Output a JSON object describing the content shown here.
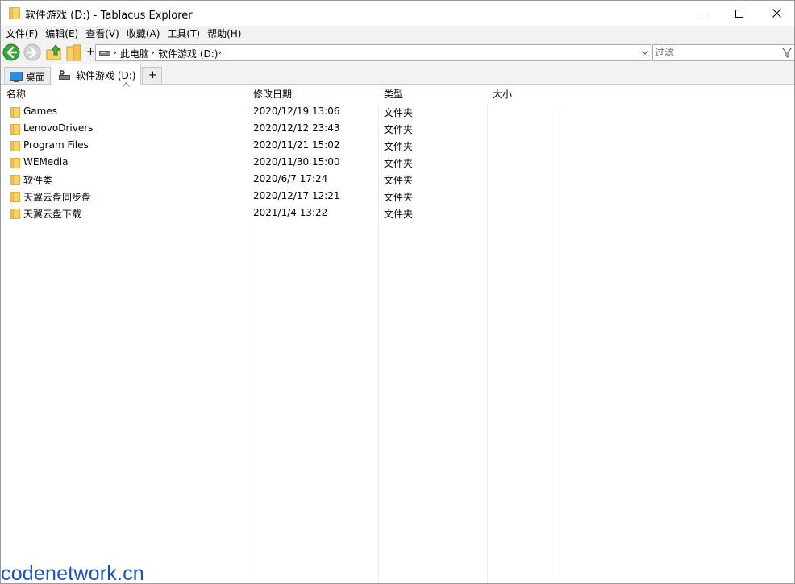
{
  "window": {
    "title": "软件游戏 (D:) - Tablacus Explorer",
    "title_icon": "folder-icon",
    "controls": [
      "minimize-icon",
      "maximize-icon",
      "close-icon"
    ]
  },
  "menu": [
    "文件(F)",
    "编辑(E)",
    "查看(V)",
    "收藏(A)",
    "工具(T)",
    "帮助(H)"
  ],
  "toolbar": {
    "icons": [
      "back-arrow-icon",
      "forward-arrow-icon",
      "up-folder-icon",
      "folders-icon"
    ],
    "new_tab_plus": "+",
    "breadcrumb": [
      "此电脑",
      "软件游戏 (D:)"
    ],
    "filter_placeholder": "过滤"
  },
  "tabs": [
    {
      "label": "桌面",
      "icon": "desktop-icon",
      "active": false
    },
    {
      "label": "软件游戏 (D:)",
      "icon": "drive-icon",
      "active": true
    },
    {
      "label": "+",
      "active": false
    }
  ],
  "columns": {
    "name": "名称",
    "modified": "修改日期",
    "type": "类型",
    "size": "大小"
  },
  "rows": [
    {
      "name": "Games",
      "modified": "2020/12/19 13:06",
      "type": "文件夹",
      "size": ""
    },
    {
      "name": "LenovoDrivers",
      "modified": "2020/12/12 23:43",
      "type": "文件夹",
      "size": ""
    },
    {
      "name": "Program Files",
      "modified": "2020/11/21 15:02",
      "type": "文件夹",
      "size": ""
    },
    {
      "name": "WEMedia",
      "modified": "2020/11/30 15:00",
      "type": "文件夹",
      "size": ""
    },
    {
      "name": "软件类",
      "modified": "2020/6/7 17:24",
      "type": "文件夹",
      "size": ""
    },
    {
      "name": "天翼云盘同步盘",
      "modified": "2020/12/17 12:21",
      "type": "文件夹",
      "size": ""
    },
    {
      "name": "天翼云盘下载",
      "modified": "2021/1/4 13:22",
      "type": "文件夹",
      "size": ""
    }
  ],
  "watermark": "codenetwork.cn",
  "colors": {
    "folder": "#f7d46b",
    "folder_dark": "#e2b23c",
    "back_button": "#3aa63a",
    "watermark": "#1a52c0"
  }
}
